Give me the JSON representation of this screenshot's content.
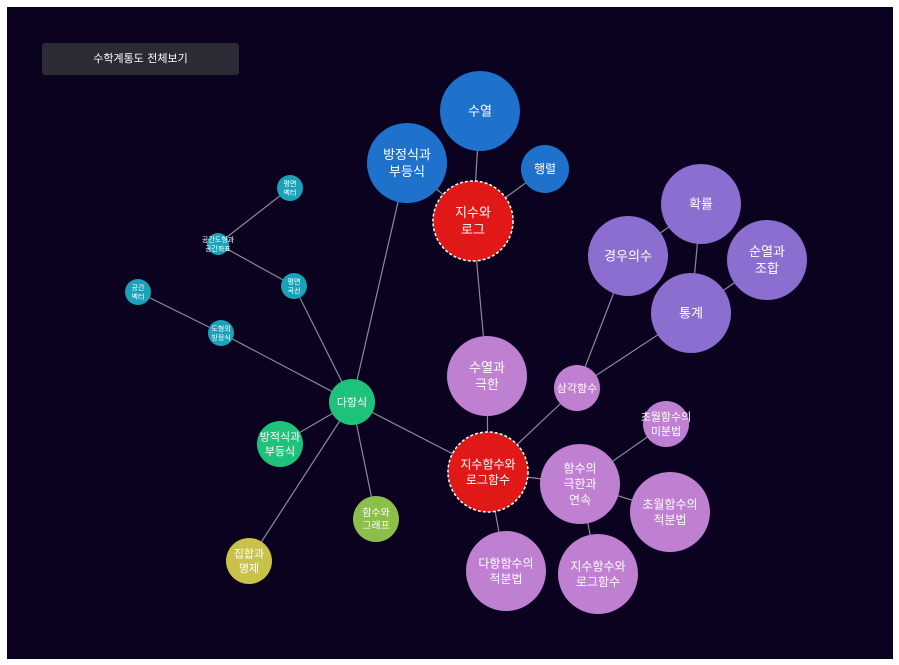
{
  "toolbar": {
    "view_all_label": "수학계통도 전체보기"
  },
  "colors": {
    "background": "#0b0220",
    "edge": "#8a8a98",
    "blue": "#1f72cc",
    "red": "#e01818",
    "purple_light": "#bf80d2",
    "purple_dark": "#8b6ed0",
    "green": "#1fc27a",
    "lime": "#8cbe4c",
    "yellow": "#c8c24a",
    "teal": "#1aa3b8"
  },
  "nodes": [
    {
      "id": "suyeol",
      "lines": [
        "수열"
      ],
      "color": "blue"
    },
    {
      "id": "bangjeongsik",
      "lines": [
        "방정식과",
        "부등식"
      ],
      "color": "blue"
    },
    {
      "id": "haengryeol",
      "lines": [
        "행렬"
      ],
      "color": "blue"
    },
    {
      "id": "jisu-log",
      "lines": [
        "지수와",
        "로그"
      ],
      "color": "red",
      "dashed": true
    },
    {
      "id": "hwakryul",
      "lines": [
        "확률"
      ],
      "color": "purple_dark"
    },
    {
      "id": "gyeongu",
      "lines": [
        "경우의수"
      ],
      "color": "purple_dark"
    },
    {
      "id": "sunyeol",
      "lines": [
        "순열과",
        "조합"
      ],
      "color": "purple_dark"
    },
    {
      "id": "tonggye",
      "lines": [
        "통계"
      ],
      "color": "purple_dark"
    },
    {
      "id": "suyeol-geukhan",
      "lines": [
        "수열과",
        "극한"
      ],
      "color": "purple_light"
    },
    {
      "id": "samgak",
      "lines": [
        "삼각함수"
      ],
      "color": "purple_light"
    },
    {
      "id": "chowol-mibun",
      "lines": [
        "초월함수의",
        "미분법"
      ],
      "color": "purple_light"
    },
    {
      "id": "jisuhamsu",
      "lines": [
        "지수함수와",
        "로그함수"
      ],
      "color": "red",
      "dashed": true
    },
    {
      "id": "hamsu-geukhan",
      "lines": [
        "함수의",
        "극한과",
        "연속"
      ],
      "color": "purple_light"
    },
    {
      "id": "chowol-jeokbun",
      "lines": [
        "초월함수의",
        "적분법"
      ],
      "color": "purple_light"
    },
    {
      "id": "dahang-jeokbun",
      "lines": [
        "다항함수의",
        "적분법"
      ],
      "color": "purple_light"
    },
    {
      "id": "jisu-log-2",
      "lines": [
        "지수함수와",
        "로그함수"
      ],
      "color": "purple_light"
    },
    {
      "id": "dahangsik",
      "lines": [
        "다항식"
      ],
      "color": "green"
    },
    {
      "id": "bangjeok",
      "lines": [
        "방적식과",
        "부등식"
      ],
      "color": "green"
    },
    {
      "id": "hamsu-graph",
      "lines": [
        "함수와",
        "그래프"
      ],
      "color": "lime"
    },
    {
      "id": "jiphap",
      "lines": [
        "집합과",
        "명제"
      ],
      "color": "yellow"
    },
    {
      "id": "pyeongmyeon-vector",
      "lines": [
        "평면",
        "벡터"
      ],
      "color": "teal"
    },
    {
      "id": "gonggan-dohyeong",
      "lines": [
        "공간도형과",
        "공간좌표"
      ],
      "color": "teal"
    },
    {
      "id": "pyeongmyeon-gokseon",
      "lines": [
        "평면",
        "곡선"
      ],
      "color": "teal"
    },
    {
      "id": "gonggan-vector",
      "lines": [
        "공간",
        "벡터"
      ],
      "color": "teal"
    },
    {
      "id": "dohyeong-bangjeong",
      "lines": [
        "도형의",
        "방정식"
      ],
      "color": "teal"
    }
  ],
  "edges": [
    [
      "suyeol",
      "jisu-log"
    ],
    [
      "bangjeongsik",
      "jisu-log"
    ],
    [
      "haengryeol",
      "jisu-log"
    ],
    [
      "jisu-log",
      "suyeol-geukhan"
    ],
    [
      "bangjeongsik",
      "dahangsik"
    ],
    [
      "pyeongmyeon-vector",
      "gonggan-dohyeong"
    ],
    [
      "gonggan-dohyeong",
      "pyeongmyeon-gokseon"
    ],
    [
      "pyeongmyeon-gokseon",
      "dahangsik"
    ],
    [
      "gonggan-vector",
      "dohyeong-bangjeong"
    ],
    [
      "dohyeong-bangjeong",
      "dahangsik"
    ],
    [
      "dahangsik",
      "bangjeok"
    ],
    [
      "dahangsik",
      "jiphap"
    ],
    [
      "dahangsik",
      "hamsu-graph"
    ],
    [
      "dahangsik",
      "jisuhamsu"
    ],
    [
      "suyeol-geukhan",
      "jisuhamsu"
    ],
    [
      "jisuhamsu",
      "samgak"
    ],
    [
      "samgak",
      "gyeongu"
    ],
    [
      "samgak",
      "tonggye"
    ],
    [
      "gyeongu",
      "hwakryul"
    ],
    [
      "hwakryul",
      "tonggye"
    ],
    [
      "sunyeol",
      "tonggye"
    ],
    [
      "jisuhamsu",
      "hamsu-geukhan"
    ],
    [
      "jisuhamsu",
      "dahang-jeokbun"
    ],
    [
      "hamsu-geukhan",
      "chowol-mibun"
    ],
    [
      "hamsu-geukhan",
      "chowol-jeokbun"
    ],
    [
      "hamsu-geukhan",
      "jisu-log-2"
    ]
  ]
}
